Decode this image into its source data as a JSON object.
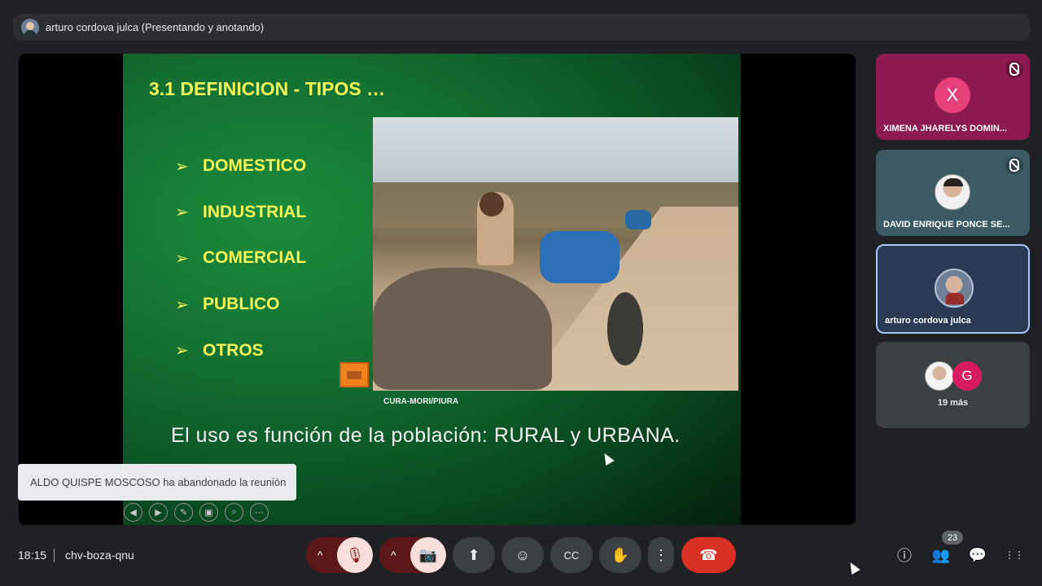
{
  "banner": {
    "presenter": "arturo cordova julca (Presentando y anotando)"
  },
  "slide": {
    "title": "3.1 DEFINICION -  TIPOS …",
    "bullets": [
      "DOMESTICO",
      "INDUSTRIAL",
      "COMERCIAL",
      "PUBLICO",
      "OTROS"
    ],
    "bullet_icon": "➢",
    "photo_caption": "CURA-MORI/PIURA",
    "subtitle": "El uso es función de la población: RURAL y URBANA."
  },
  "toast": {
    "message": "ALDO QUISPE MOSCOSO ha abandonado la reunión"
  },
  "participants": [
    {
      "name": "XIMENA JHARELYS DOMIN...",
      "initial": "X",
      "muted": true
    },
    {
      "name": "DAVID ENRIQUE PONCE SE...",
      "muted": true
    },
    {
      "name": "arturo cordova julca"
    }
  ],
  "more": {
    "initial": "G",
    "label": "19 más"
  },
  "footer": {
    "time": "18:15",
    "meeting_code": "chv-boza-qnu",
    "people_count": "23"
  },
  "icons": {
    "caret_up": "^",
    "mic_off": "🎙",
    "camera_off": "📷",
    "present": "⬆",
    "emoji": "☺",
    "captions": "CC",
    "raise_hand": "✋",
    "more": "⋮",
    "end_call": "☎",
    "info": "ⓘ",
    "people": "👥",
    "chat": "💬",
    "apps": "⋮⋮"
  },
  "colors": {
    "accent_yellow": "#f3f55a",
    "end_call_red": "#d93025",
    "active_tile_border": "#a8c7fa"
  }
}
